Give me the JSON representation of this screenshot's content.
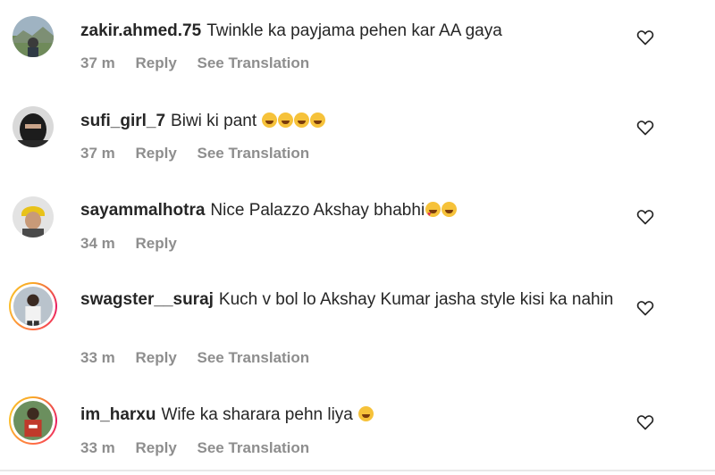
{
  "comments": [
    {
      "username": "zakir.ahmed.75",
      "text": "Twinkle ka payjama pehen kar AA gaya",
      "emojis": [],
      "time": "37 m",
      "reply": "Reply",
      "translation": "See Translation",
      "avatar": "avatar-photo-outdoor"
    },
    {
      "username": "sufi_girl_7",
      "text": "Biwi ki pant",
      "emojis": [
        "laughing-tears",
        "laughing-tears",
        "laughing-tears",
        "laughing-tears"
      ],
      "time": "37 m",
      "reply": "Reply",
      "translation": "See Translation",
      "avatar": "avatar-photo-masked"
    },
    {
      "username": "sayammalhotra",
      "text": "Nice Palazzo Akshay bhabhi",
      "emojis": [
        "heart-eyes",
        "laughing-tears"
      ],
      "time": "34 m",
      "reply": "Reply",
      "translation": "",
      "avatar": "avatar-photo-yellow-cap"
    },
    {
      "username": "swagster__suraj",
      "text": "Kuch v bol lo Akshay Kumar jasha style kisi ka nahin",
      "emojis": [],
      "time": "33 m",
      "reply": "Reply",
      "translation": "See Translation",
      "avatar": "avatar-photo-story-ring"
    },
    {
      "username": "im_harxu",
      "text": "Wife ka sharara pehn liya",
      "emojis": [
        "laughing-tears"
      ],
      "time": "33 m",
      "reply": "Reply",
      "translation": "See Translation",
      "avatar": "avatar-photo-story-ring"
    }
  ],
  "icons": {
    "like": "heart-outline-icon"
  },
  "colors": {
    "text": "#262626",
    "meta": "#8e8e8e",
    "story_ring": "#e91e63"
  }
}
